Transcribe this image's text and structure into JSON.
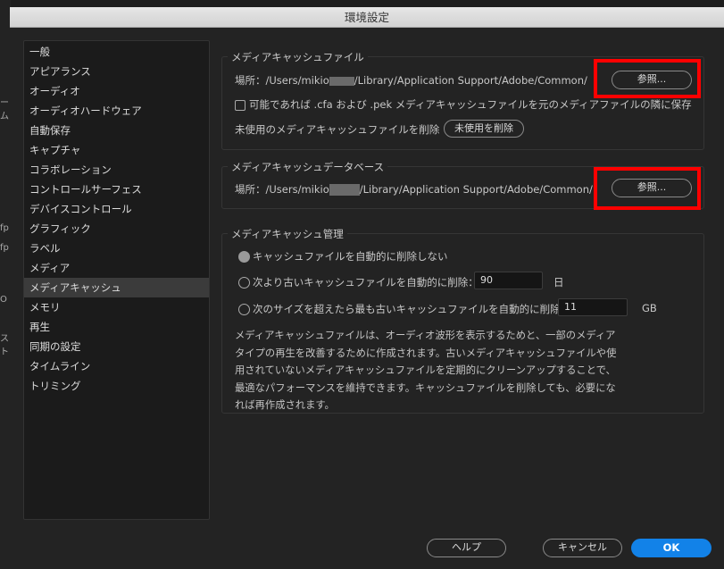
{
  "window": {
    "title": "環境設定"
  },
  "background_app": {
    "fragments": [
      "ーム",
      "fp",
      "fp",
      "O",
      "スト"
    ]
  },
  "sidebar": {
    "items": [
      {
        "label": "一般"
      },
      {
        "label": "アピアランス"
      },
      {
        "label": "オーディオ"
      },
      {
        "label": "オーディオハードウェア"
      },
      {
        "label": "自動保存"
      },
      {
        "label": "キャプチャ"
      },
      {
        "label": "コラボレーション"
      },
      {
        "label": "コントロールサーフェス"
      },
      {
        "label": "デバイスコントロール"
      },
      {
        "label": "グラフィック"
      },
      {
        "label": "ラベル"
      },
      {
        "label": "メディア"
      },
      {
        "label": "メディアキャッシュ",
        "selected": true
      },
      {
        "label": "メモリ"
      },
      {
        "label": "再生"
      },
      {
        "label": "同期の設定"
      },
      {
        "label": "タイムライン"
      },
      {
        "label": "トリミング"
      }
    ]
  },
  "cache_files": {
    "title": "メディアキャッシュファイル",
    "location_label": "場所：",
    "path_prefix": "/Users/mikio",
    "path_suffix": "/Library/Application Support/Adobe/Common/",
    "browse_label": "参照...",
    "save_next_label": "可能であれば .cfa および .pek メディアキャッシュファイルを元のメディアファイルの隣に保存",
    "save_next_checked": false,
    "delete_unused_text": "未使用のメディアキャッシュファイルを削除",
    "delete_unused_button": "未使用を削除"
  },
  "cache_db": {
    "title": "メディアキャッシュデータベース",
    "location_label": "場所：",
    "path_prefix": "/Users/mikio",
    "path_suffix": "/Library/Application Support/Adobe/Common/",
    "browse_label": "参照..."
  },
  "cache_mgmt": {
    "title": "メディアキャッシュ管理",
    "opt_never": "キャッシュファイルを自動的に削除しない",
    "opt_older": "次より古いキャッシュファイルを自動的に削除：",
    "older_value": "90",
    "older_unit": "日",
    "opt_size": "次のサイズを超えたら最も古いキャッシュファイルを自動的に削除：",
    "size_value": "11",
    "size_unit": "GB",
    "selected": "never",
    "description": "メディアキャッシュファイルは、オーディオ波形を表示するためと、一部のメディアタイプの再生を改善するために作成されます。古いメディアキャッシュファイルや使用されていないメディアキャッシュファイルを定期的にクリーンアップすることで、最適なパフォーマンスを維持できます。キャッシュファイルを削除しても、必要になれば再作成されます。"
  },
  "footer": {
    "help": "ヘルプ",
    "cancel": "キャンセル",
    "ok": "OK"
  },
  "colors": {
    "accent": "#1282e8",
    "highlight": "#ff0000"
  }
}
